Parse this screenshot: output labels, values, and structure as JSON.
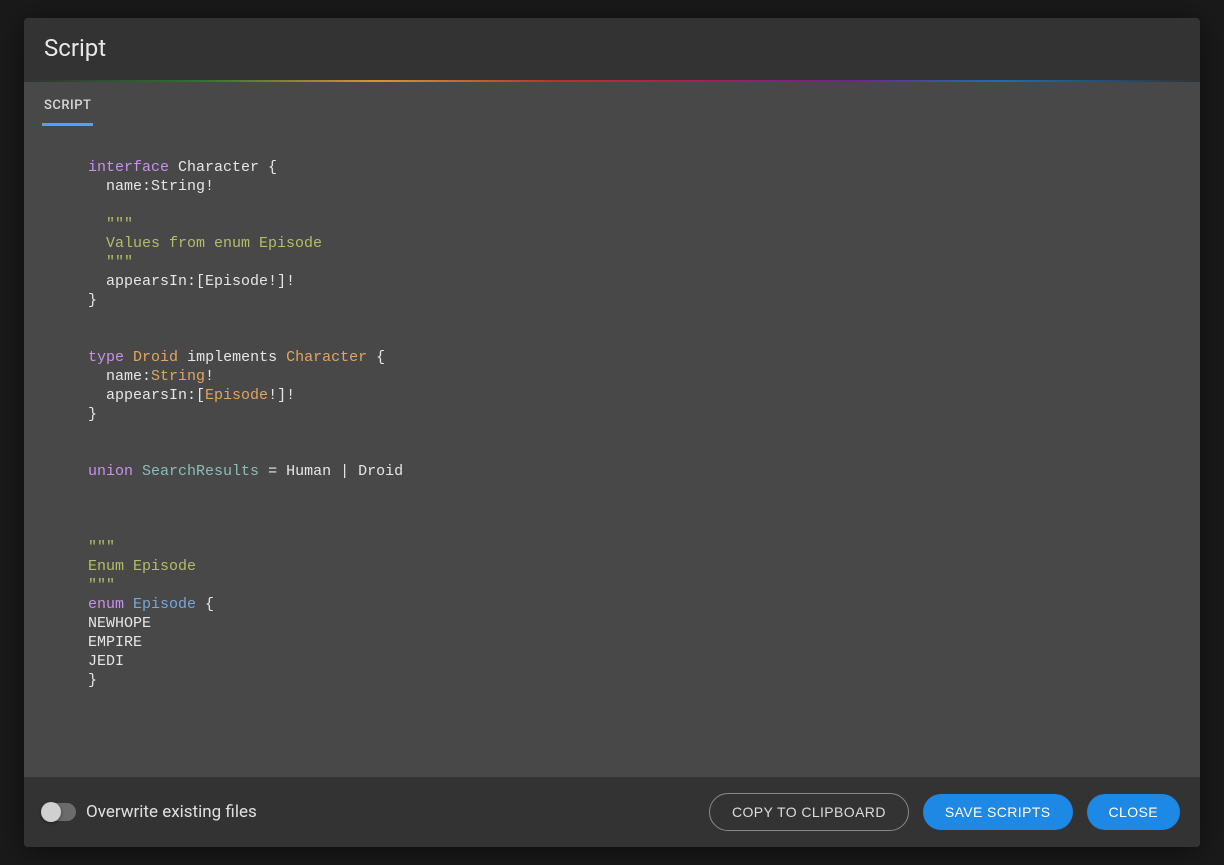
{
  "modal": {
    "title": "Script"
  },
  "tabs": {
    "script": "SCRIPT"
  },
  "code": {
    "lines": [
      {
        "t": "interface-decl",
        "kw": "interface",
        "name": "Character",
        "tail": " {"
      },
      {
        "t": "field",
        "indent": 2,
        "name": "name",
        "type": "String",
        "bang": "!"
      },
      {
        "t": "blank"
      },
      {
        "t": "doc",
        "indent": 2,
        "text": "\"\"\""
      },
      {
        "t": "doc",
        "indent": 2,
        "text": "Values from enum Episode"
      },
      {
        "t": "doc",
        "indent": 2,
        "text": "\"\"\""
      },
      {
        "t": "list-field",
        "indent": 2,
        "name": "appearsIn",
        "type": "Episode",
        "tail": "!]!"
      },
      {
        "t": "plain",
        "text": "}"
      },
      {
        "t": "blank"
      },
      {
        "t": "blank"
      },
      {
        "t": "type-decl",
        "kw": "type",
        "name": "Droid",
        "impl_kw": "implements",
        "impl_name": "Character",
        "tail": " {"
      },
      {
        "t": "field-typed",
        "indent": 2,
        "name": "name",
        "type": "String",
        "bang": "!"
      },
      {
        "t": "list-field-typed",
        "indent": 2,
        "name": "appearsIn",
        "type": "Episode",
        "tail": "!]!"
      },
      {
        "t": "plain",
        "text": "}"
      },
      {
        "t": "blank"
      },
      {
        "t": "blank"
      },
      {
        "t": "union-decl",
        "kw": "union",
        "name": "SearchResults",
        "tail": " = Human | Droid"
      },
      {
        "t": "blank"
      },
      {
        "t": "blank"
      },
      {
        "t": "blank"
      },
      {
        "t": "doc",
        "indent": 0,
        "text": "\"\"\""
      },
      {
        "t": "doc",
        "indent": 0,
        "text": "Enum Episode"
      },
      {
        "t": "doc",
        "indent": 0,
        "text": "\"\"\""
      },
      {
        "t": "enum-decl",
        "kw": "enum",
        "name": "Episode",
        "tail": " {"
      },
      {
        "t": "plain",
        "text": "NEWHOPE"
      },
      {
        "t": "plain",
        "text": "EMPIRE"
      },
      {
        "t": "plain",
        "text": "JEDI"
      },
      {
        "t": "plain",
        "text": "}"
      }
    ]
  },
  "footer": {
    "toggle_label": "Overwrite existing files",
    "copy": "COPY TO CLIPBOARD",
    "save": "SAVE SCRIPTS",
    "close": "CLOSE"
  }
}
